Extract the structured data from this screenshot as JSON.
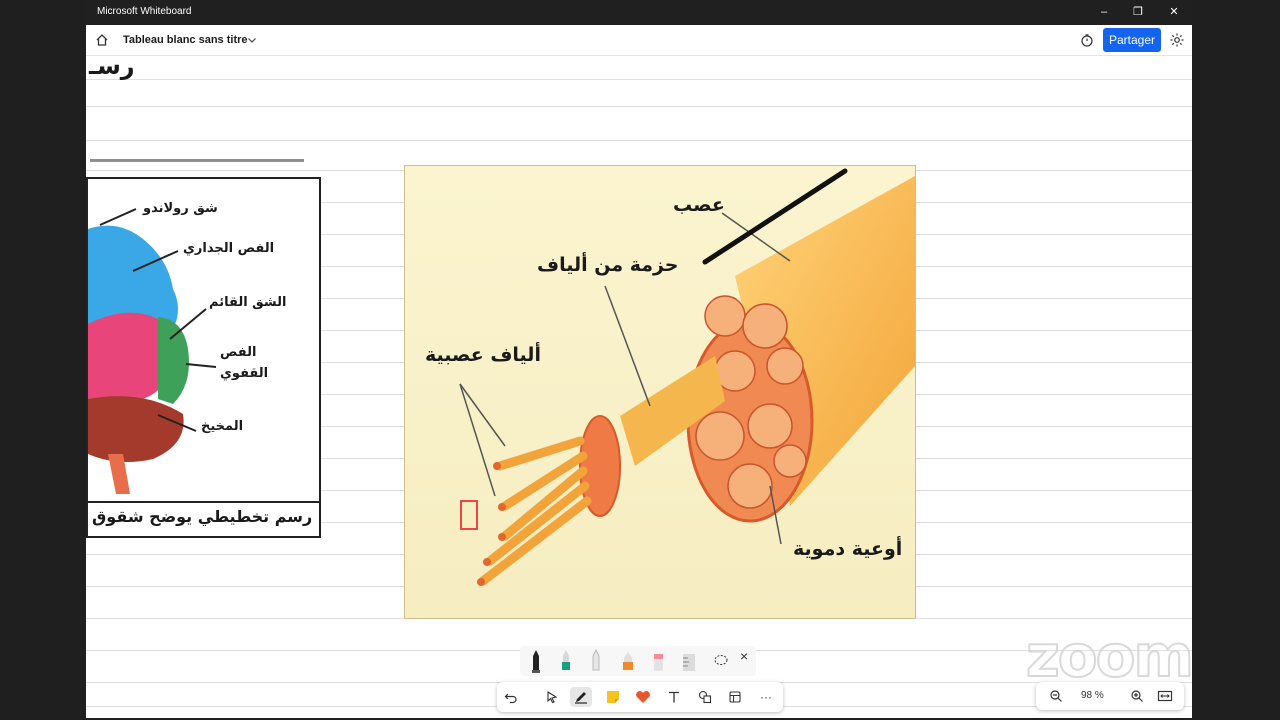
{
  "window": {
    "app_title": "Microsoft Whiteboard",
    "minimize": "–",
    "restore": "❐",
    "close": "✕"
  },
  "header": {
    "board_title": "Tableau blanc sans titre",
    "share_label": "Partager"
  },
  "left_figure": {
    "labels": [
      "شق رولاندو",
      "الفص الجداري",
      "الشق القائم",
      "الفص",
      "القفوي",
      "المخيخ"
    ],
    "caption": "رسم تخطيطي يوضح شقوق",
    "top_fragment": "رسـ"
  },
  "nerve_figure": {
    "labels": {
      "nerve": "عصب",
      "bundle": "حزمة من ألياف",
      "fibers": "ألياف عصبية",
      "vessels": "أوعية دموية"
    }
  },
  "pen_tray": {
    "close": "×"
  },
  "toolbar": {
    "more": "···"
  },
  "zoom": {
    "value": "98 %"
  },
  "watermark": "zoom",
  "colors": {
    "accent": "#1464f0",
    "titlebar": "#202020"
  }
}
